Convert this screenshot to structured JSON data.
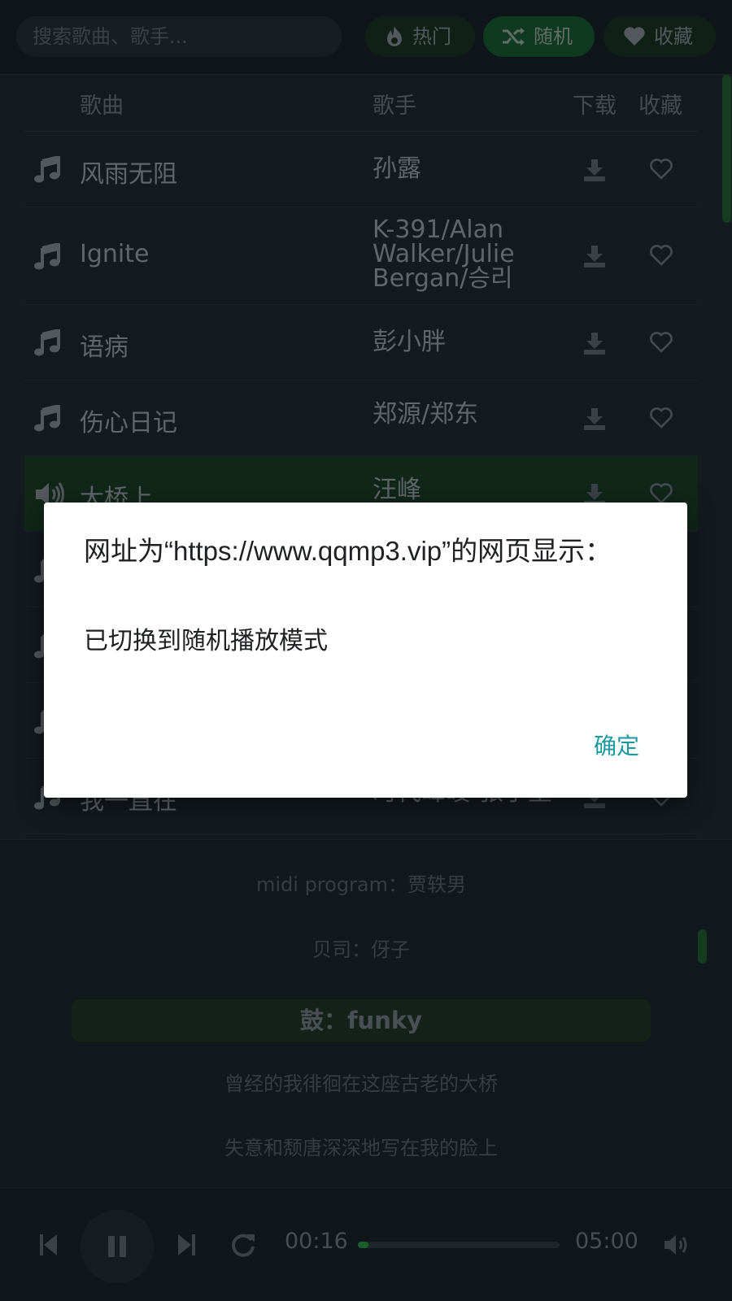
{
  "topbar": {
    "search_placeholder": "搜索歌曲、歌手...",
    "buttons": [
      {
        "label": "热门",
        "icon": "fire-icon"
      },
      {
        "label": "随机",
        "icon": "shuffle-icon",
        "active": true
      },
      {
        "label": "收藏",
        "icon": "heart-icon"
      }
    ]
  },
  "table": {
    "headers": {
      "song": "歌曲",
      "artist": "歌手",
      "download": "下载",
      "favorite": "收藏"
    },
    "rows": [
      {
        "title": "风雨无阻",
        "artist": "孙露"
      },
      {
        "title": "Ignite",
        "artist": "K-391/Alan Walker/Julie Bergan/승리"
      },
      {
        "title": "语病",
        "artist": "彭小胖"
      },
      {
        "title": "伤心日记",
        "artist": "郑源/郑东"
      },
      {
        "title": "大桥上",
        "artist": "汪峰",
        "playing": true
      },
      {
        "title": "",
        "artist": ""
      },
      {
        "title": "",
        "artist": ""
      },
      {
        "title": "",
        "artist": ""
      },
      {
        "title": "我一直在",
        "artist": "时代峰峻-张子墨"
      }
    ]
  },
  "lyrics": {
    "lines": [
      "midi program：贾轶男",
      "贝司：伢子",
      "鼓：funky",
      "曾经的我徘徊在这座古老的大桥",
      "失意和颓唐深深地写在我的脸上"
    ],
    "active_index": 2
  },
  "player": {
    "current_time": "00:16",
    "total_time": "05:00",
    "progress_fraction": 0.053
  },
  "dialog": {
    "title": "网址为“https://www.qqmp3.vip”的网页显示：",
    "message": "已切换到随机播放模式",
    "ok_label": "确定"
  },
  "colors": {
    "accent_green": "#1f7a3a",
    "dialog_button": "#1a9aa0"
  }
}
